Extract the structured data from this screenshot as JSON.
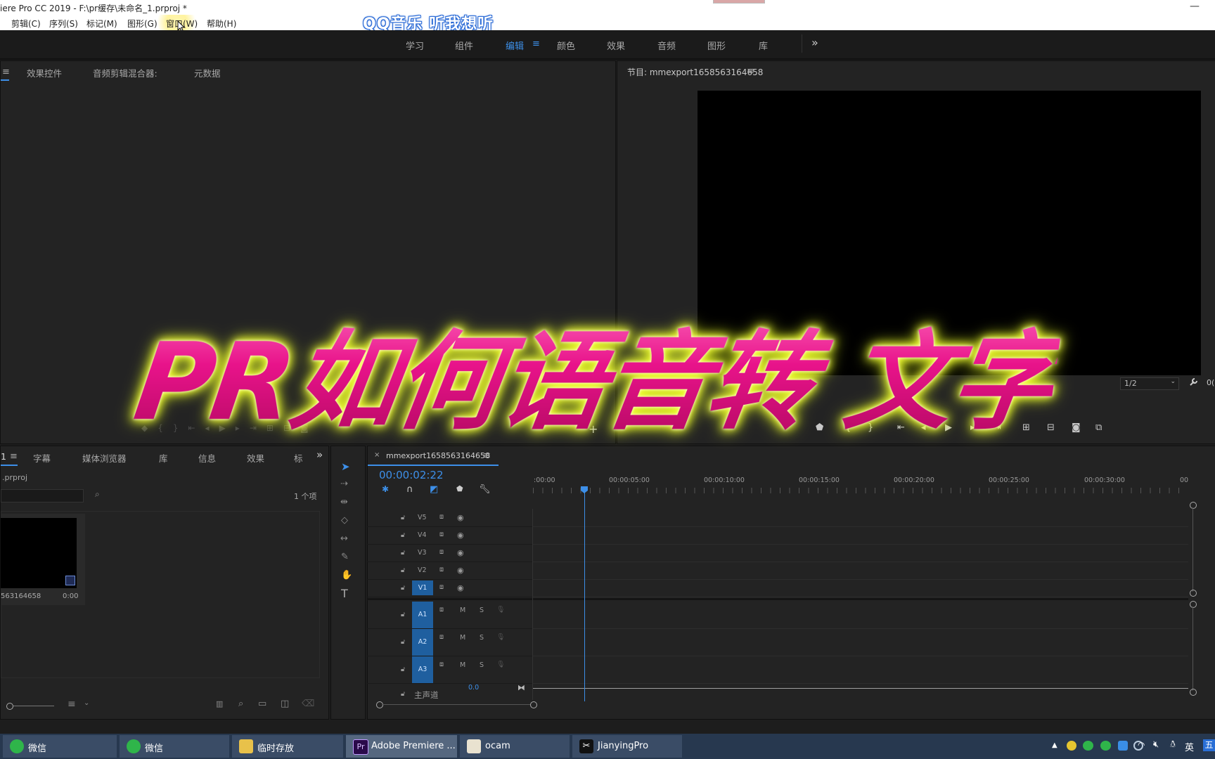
{
  "titlebar": {
    "title": "iere Pro CC 2019 - F:\\pr缓存\\未命名_1.prproj *",
    "close": "—"
  },
  "menubar": {
    "items": [
      "剪辑(C)",
      "序列(S)",
      "标记(M)",
      "图形(G)",
      "窗口(W)",
      "帮助(H)"
    ]
  },
  "overlay": {
    "qqmusic": "QQ音乐 听我想听",
    "big_title": "PR如何语音转 文字"
  },
  "workspaces": {
    "items": [
      "学习",
      "组件",
      "编辑",
      "颜色",
      "效果",
      "音频",
      "图形",
      "库"
    ],
    "active": "编辑",
    "more": "»",
    "menu_icon": "≡"
  },
  "source_panel": {
    "tabs": [
      "效果控件",
      "音频剪辑混合器:",
      "元数据"
    ]
  },
  "program_panel": {
    "title": "节目: mmexport1658563164658",
    "zoom": "1/2",
    "timecode_partial": "0("
  },
  "project_panel": {
    "tabs": [
      "字幕",
      "媒体浏览器",
      "库",
      "信息",
      "效果",
      "标"
    ],
    "first_tab": "1",
    "project_name": ".prproj",
    "item_count": "1 个项",
    "clip_name": "563164658",
    "clip_duration": "0:00"
  },
  "timeline": {
    "sequence_name": "mmexport1658563164658",
    "timecode": "00:00:02:22",
    "ruler": [
      ":00:00",
      "00:00:05:00",
      "00:00:10:00",
      "00:00:15:00",
      "00:00:20:00",
      "00:00:25:00",
      "00:00:30:00",
      "00"
    ],
    "video_tracks": [
      "V5",
      "V4",
      "V3",
      "V2",
      "V1"
    ],
    "audio_tracks": [
      "A1",
      "A2",
      "A3"
    ],
    "mute": "M",
    "solo": "S",
    "master": "主声道",
    "master_value": "0.0"
  },
  "taskbar": {
    "items": [
      "微信",
      "微信",
      "临时存放",
      "Adobe Premiere ...",
      "ocam",
      "JianyingPro"
    ],
    "tray_lang": "英",
    "tray_ime": "五"
  }
}
